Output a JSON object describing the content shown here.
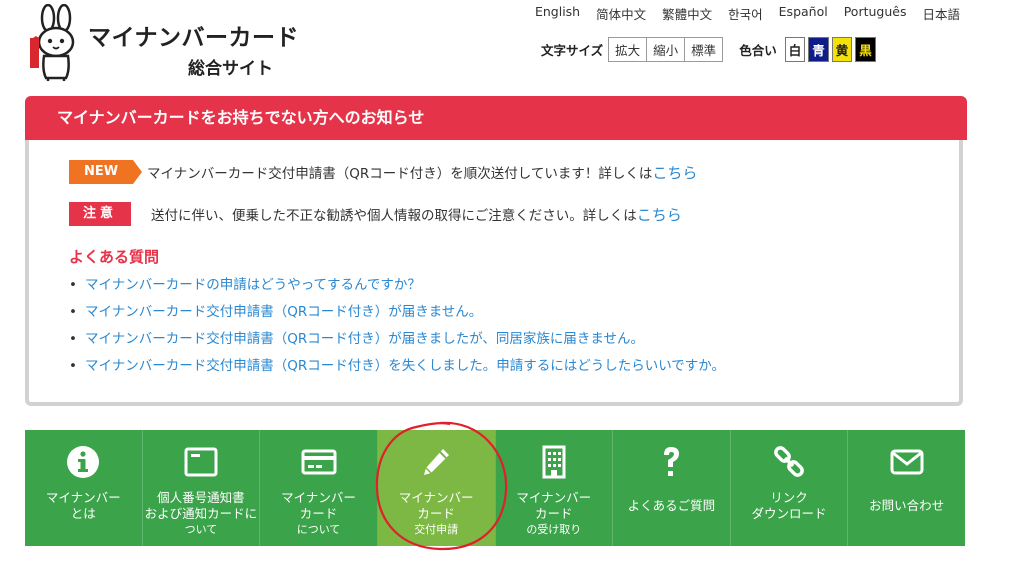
{
  "header": {
    "title": "マイナンバーカード",
    "subtitle": "総合サイト"
  },
  "languages": [
    "English",
    "简体中文",
    "繁體中文",
    "한국어",
    "Español",
    "Português",
    "日本語"
  ],
  "tools": {
    "font_size_label": "文字サイズ",
    "font_size_buttons": [
      "拡大",
      "縮小",
      "標準"
    ],
    "color_label": "色合い",
    "color_buttons": [
      "白",
      "青",
      "黄",
      "黒"
    ]
  },
  "notice": {
    "title": "マイナンバーカードをお持ちでない方へのお知らせ",
    "new_badge": "NEW",
    "new_text": "マイナンバーカード交付申請書（QRコード付き）を順次送付しています！詳しくは",
    "new_link": "こちら",
    "caution_badge": "注意",
    "caution_text": "送付に伴い、便乗した不正な勧誘や個人情報の取得にご注意ください。詳しくは",
    "caution_link": "こちら",
    "faq_title": "よくある質問",
    "faq": [
      "マイナンバーカードの申請はどうやってするんですか？",
      "マイナンバーカード交付申請書（QRコード付き）が届きません。",
      "マイナンバーカード交付申請書（QRコード付き）が届きましたが、同居家族に届きません。",
      "マイナンバーカード交付申請書（QRコード付き）を失くしました。申請するにはどうしたらいいですか。"
    ]
  },
  "nav": [
    {
      "line1": "マイナンバー",
      "line2": "とは",
      "icon": "info-icon"
    },
    {
      "line1": "個人番号通知書",
      "line2": "および通知カードに",
      "line3": "ついて",
      "icon": "notification-card-icon"
    },
    {
      "line1": "マイナンバー",
      "line2": "カード",
      "line3": "について",
      "icon": "card-icon"
    },
    {
      "line1": "マイナンバー",
      "line2": "カード",
      "line3": "交付申請",
      "icon": "pencil-icon",
      "active": true
    },
    {
      "line1": "マイナンバー",
      "line2": "カード",
      "line3": "の受け取り",
      "icon": "building-icon"
    },
    {
      "line1": "よくあるご質問",
      "icon": "question-icon"
    },
    {
      "line1": "リンク",
      "line2": "ダウンロード",
      "icon": "link-icon"
    },
    {
      "line1": "お問い合わせ",
      "icon": "mail-icon"
    }
  ],
  "colors": {
    "accent_red": "#e5334a",
    "nav_green": "#3ba34a",
    "nav_active": "#7db844",
    "link_blue": "#2a88d2",
    "new_orange": "#f07322"
  }
}
